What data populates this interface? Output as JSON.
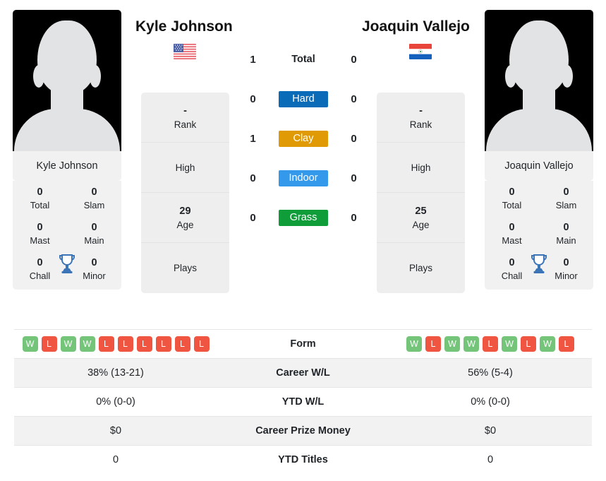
{
  "players": {
    "left": {
      "name": "Kyle Johnson",
      "country": "usa-flag",
      "photo_caption": "Kyle Johnson",
      "titles": [
        {
          "value": "0",
          "label": "Total"
        },
        {
          "value": "0",
          "label": "Slam"
        },
        {
          "value": "0",
          "label": "Mast"
        },
        {
          "value": "0",
          "label": "Main"
        },
        {
          "value": "0",
          "label": "Chall"
        },
        {
          "value": "0",
          "label": "Minor"
        }
      ],
      "info": [
        {
          "value": "-",
          "label": "Rank"
        },
        {
          "value": "",
          "label": "High"
        },
        {
          "value": "29",
          "label": "Age"
        },
        {
          "value": "",
          "label": "Plays"
        }
      ],
      "surface_counts": {
        "total": "1",
        "hard": "0",
        "clay": "1",
        "indoor": "0",
        "grass": "0"
      },
      "form": [
        "W",
        "L",
        "W",
        "W",
        "L",
        "L",
        "L",
        "L",
        "L",
        "L"
      ],
      "career_wl": "38% (13-21)",
      "ytd_wl": "0% (0-0)",
      "career_prize_money": "$0",
      "ytd_titles": "0"
    },
    "right": {
      "name": "Joaquin Vallejo",
      "country": "paraguay-flag",
      "photo_caption": "Joaquin Vallejo",
      "titles": [
        {
          "value": "0",
          "label": "Total"
        },
        {
          "value": "0",
          "label": "Slam"
        },
        {
          "value": "0",
          "label": "Mast"
        },
        {
          "value": "0",
          "label": "Main"
        },
        {
          "value": "0",
          "label": "Chall"
        },
        {
          "value": "0",
          "label": "Minor"
        }
      ],
      "info": [
        {
          "value": "-",
          "label": "Rank"
        },
        {
          "value": "",
          "label": "High"
        },
        {
          "value": "25",
          "label": "Age"
        },
        {
          "value": "",
          "label": "Plays"
        }
      ],
      "surface_counts": {
        "total": "0",
        "hard": "0",
        "clay": "0",
        "indoor": "0",
        "grass": "0"
      },
      "form": [
        "W",
        "L",
        "W",
        "W",
        "L",
        "W",
        "L",
        "W",
        "L"
      ],
      "career_wl": "56% (5-4)",
      "ytd_wl": "0% (0-0)",
      "career_prize_money": "$0",
      "ytd_titles": "0"
    }
  },
  "surfaces": [
    {
      "key": "total",
      "label": "Total",
      "color": "transparent"
    },
    {
      "key": "hard",
      "label": "Hard",
      "color": "#0a6cb8"
    },
    {
      "key": "clay",
      "label": "Clay",
      "color": "#e09a05"
    },
    {
      "key": "indoor",
      "label": "Indoor",
      "color": "#3498eb"
    },
    {
      "key": "grass",
      "label": "Grass",
      "color": "#0f9d3a"
    }
  ],
  "table_rows": [
    {
      "label": "Form",
      "key": "form"
    },
    {
      "label": "Career W/L",
      "key": "career_wl"
    },
    {
      "label": "YTD W/L",
      "key": "ytd_wl"
    },
    {
      "label": "Career Prize Money",
      "key": "career_prize_money"
    },
    {
      "label": "YTD Titles",
      "key": "ytd_titles"
    }
  ],
  "colors": {
    "win": "#74c47a",
    "loss": "#ef5540",
    "trophy": "#3b75b8",
    "card_bg": "#f1f1f1",
    "alt_row": "#f2f2f2"
  }
}
